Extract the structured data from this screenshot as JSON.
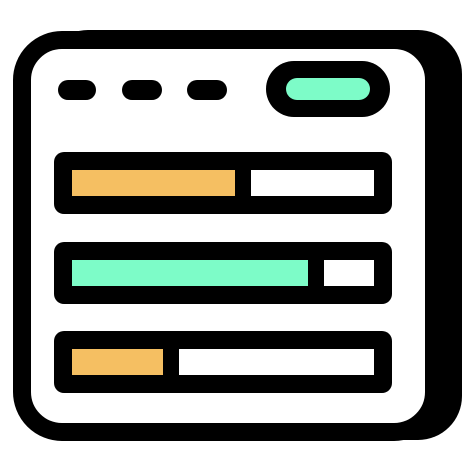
{
  "icon": {
    "name": "dashboard-progress-bars-icon",
    "colors": {
      "outline": "#000000",
      "window": "#ffffff",
      "shadow": "#000000",
      "accent_green": "#7dfcc8",
      "accent_orange": "#f5bf62",
      "track": "#ffffff"
    },
    "header": {
      "dot_count": 3,
      "pill_color": "#7dfcc8"
    },
    "progress_bars": [
      {
        "name": "progress-bar-1",
        "fill_fraction": 0.54,
        "color": "#f5bf62"
      },
      {
        "name": "progress-bar-2",
        "fill_fraction": 0.78,
        "color": "#7dfcc8"
      },
      {
        "name": "progress-bar-3",
        "fill_fraction": 0.3,
        "color": "#f5bf62"
      }
    ]
  }
}
